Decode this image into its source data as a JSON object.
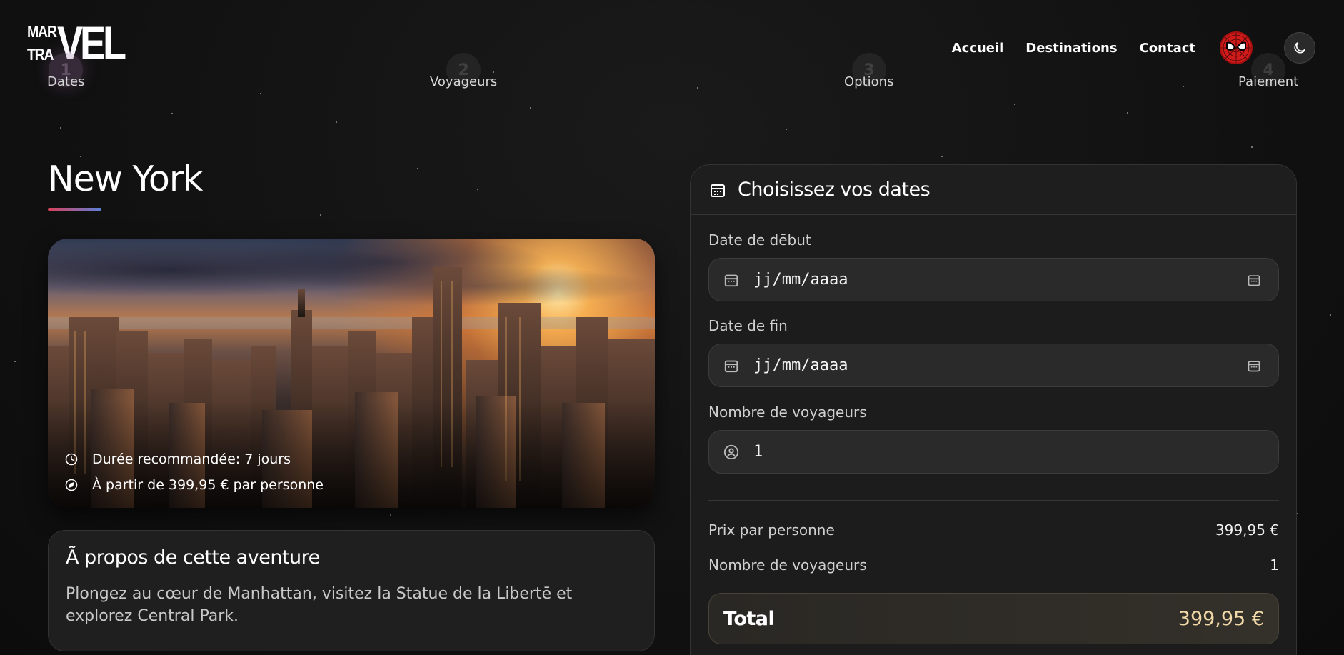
{
  "header": {
    "logo_small_top": "MAR",
    "logo_small_bottom": "TRA",
    "logo_big": "VEL",
    "nav": [
      "Accueil",
      "Destinations",
      "Contact"
    ],
    "avatar_icon": "spiderman-avatar-icon",
    "theme_icon": "moon-icon"
  },
  "stepper": {
    "steps": [
      {
        "number": "1",
        "label": "Dates",
        "active": true
      },
      {
        "number": "2",
        "label": "Voyageurs",
        "active": false
      },
      {
        "number": "3",
        "label": "Options",
        "active": false
      },
      {
        "number": "4",
        "label": "Paiement",
        "active": false
      }
    ]
  },
  "destination": {
    "title": "New York",
    "duration": "Durée recommandée: 7 jours",
    "price_from": "À partir de 399,95 € par personne",
    "about_title": "Ã propos de cette aventure",
    "about_text": "Plongez au cœur de Manhattan, visitez la Statue de la Libertē et explorez Central Park."
  },
  "booking": {
    "title": "Choisissez vos dates",
    "start_label": "Date de dēbut",
    "start_placeholder": "jj/mm/aaaa",
    "end_label": "Date de fin",
    "end_placeholder": "jj/mm/aaaa",
    "travelers_label": "Nombre de voyageurs",
    "travelers_value": "1",
    "price_label": "Prix par personne",
    "price_value": "399,95 €",
    "count_label": "Nombre de voyageurs",
    "count_value": "1",
    "total_label": "Total",
    "total_value": "399,95 €"
  },
  "colors": {
    "background": "#121212",
    "panel": "#1c1c1c",
    "accent_total": "#f1d9a8",
    "underline_start": "#d9415a",
    "underline_end": "#5c7fd8"
  }
}
